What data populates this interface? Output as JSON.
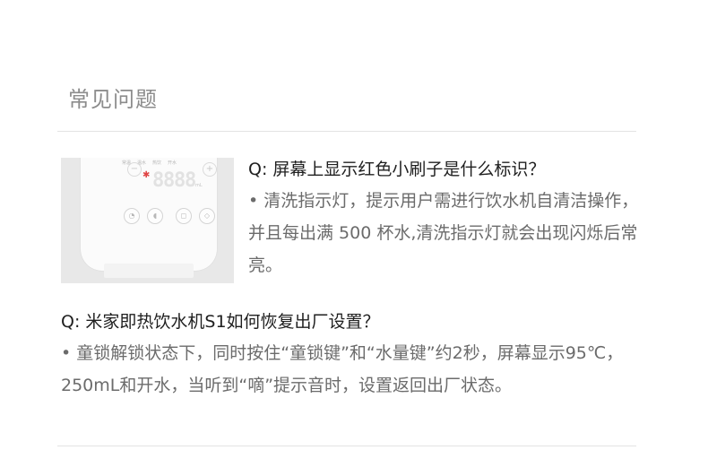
{
  "faq": {
    "section_title": "常见问题",
    "items": [
      {
        "question": "Q: 屏幕上显示红色小刷子是什么标识？",
        "answer": "• 清洗指示灯，提示用户需进行饮水机自清洁操作，并且每出满 500 杯水,清洗指示灯就会出现闪烁后常亮。"
      },
      {
        "question": "Q: 米家即热饮水机S1如何恢复出厂设置？",
        "answer": "• 童锁解锁状态下，同时按住“童锁键”和“水量键”约2秒，屏幕显示95℃，250mL和开水，当听到“嘀”提示音时，设置返回出厂状态。"
      }
    ],
    "product_panel": {
      "labels": [
        "常温",
        "温水",
        "热饮",
        "开水"
      ],
      "display_digits": [
        "8",
        "8",
        "8",
        "8"
      ],
      "unit_label": "mL",
      "minus_symbol": "−",
      "plus_symbol": "+",
      "brush_symbol": "✱",
      "button_symbols": [
        "◔",
        "◖",
        "◻",
        "◇"
      ],
      "brush_color": "#e04545"
    }
  }
}
